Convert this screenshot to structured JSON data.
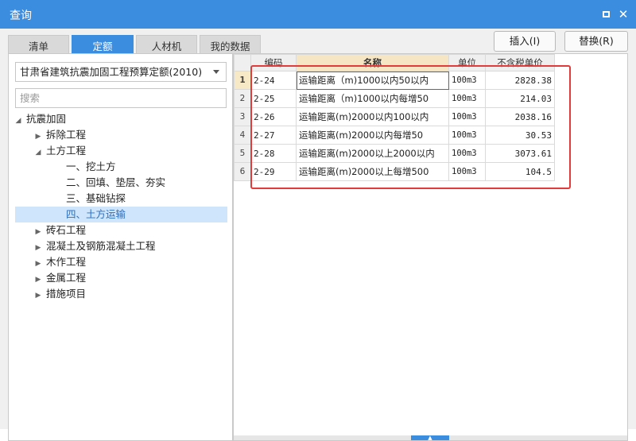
{
  "window": {
    "title": "查询",
    "maximize_icon": "maximize-icon",
    "close_icon": "close-icon",
    "close_glyph": "✕"
  },
  "tabs": [
    {
      "label": "清单",
      "active": false
    },
    {
      "label": "定额",
      "active": true
    },
    {
      "label": "人材机",
      "active": false
    },
    {
      "label": "我的数据",
      "active": false
    }
  ],
  "actions": {
    "insert_label": "插入(I)",
    "replace_label": "替换(R)"
  },
  "left": {
    "quota_select": "甘肃省建筑抗震加固工程预算定额(2010)",
    "search_placeholder": "搜索",
    "tree": [
      {
        "label": "抗震加固",
        "toggle": "◢"
      },
      {
        "label": "拆除工程",
        "toggle": "▶"
      },
      {
        "label": "土方工程",
        "toggle": "◢"
      },
      {
        "label": "一、挖土方",
        "toggle": ""
      },
      {
        "label": "二、回填、垫层、夯实",
        "toggle": ""
      },
      {
        "label": "三、基础钻探",
        "toggle": ""
      },
      {
        "label": "四、土方运输",
        "toggle": "",
        "selected": true
      },
      {
        "label": "砖石工程",
        "toggle": "▶"
      },
      {
        "label": "混凝土及钢筋混凝土工程",
        "toggle": "▶"
      },
      {
        "label": "木作工程",
        "toggle": "▶"
      },
      {
        "label": "金属工程",
        "toggle": "▶"
      },
      {
        "label": "措施项目",
        "toggle": "▶"
      }
    ]
  },
  "grid": {
    "headers": {
      "code": "编码",
      "name": "名称",
      "unit": "单位",
      "price": "不含税单价"
    },
    "rows": [
      {
        "num": "1",
        "code": "2-24",
        "name": "运输距离（m)1000以内50以内",
        "unit": "100m3",
        "price": "2828.38"
      },
      {
        "num": "2",
        "code": "2-25",
        "name": "运输距离（m)1000以内每增50",
        "unit": "100m3",
        "price": "214.03"
      },
      {
        "num": "3",
        "code": "2-26",
        "name": "运输距离(m)2000以内100以内",
        "unit": "100m3",
        "price": "2038.16"
      },
      {
        "num": "4",
        "code": "2-27",
        "name": "运输距离(m)2000以内每增50",
        "unit": "100m3",
        "price": "30.53"
      },
      {
        "num": "5",
        "code": "2-28",
        "name": "运输距离(m)2000以上2000以内",
        "unit": "100m3",
        "price": "3073.61"
      },
      {
        "num": "6",
        "code": "2-29",
        "name": "运输距离(m)2000以上每增500",
        "unit": "100m3",
        "price": "104.5"
      }
    ]
  },
  "colors": {
    "accent": "#3b8de0",
    "highlight_box": "#e23b3b",
    "selected_tree_bg": "#cfe5fb"
  }
}
